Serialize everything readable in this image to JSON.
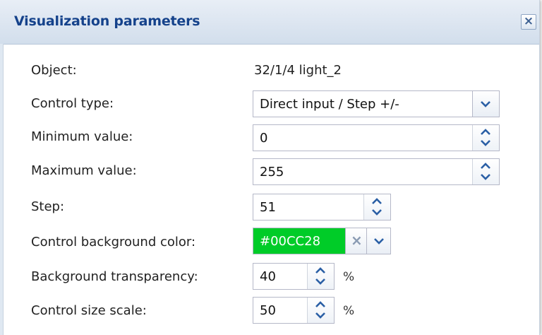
{
  "dialog": {
    "title": "Visualization parameters",
    "close_symbol": "×"
  },
  "form": {
    "object": {
      "label": "Object:",
      "value": "32/1/4 light_2"
    },
    "control_type": {
      "label": "Control type:",
      "value": "Direct input / Step +/-"
    },
    "minimum": {
      "label": "Minimum value:",
      "value": "0"
    },
    "maximum": {
      "label": "Maximum value:",
      "value": "255"
    },
    "step": {
      "label": "Step:",
      "value": "51"
    },
    "bg_color": {
      "label": "Control background color:",
      "value": "#00CC28",
      "swatch": "#00CC28",
      "clear_symbol": "×"
    },
    "transparency": {
      "label": "Background transparency:",
      "value": "40",
      "unit": "%"
    },
    "size_scale": {
      "label": "Control size scale:",
      "value": "50",
      "unit": "%"
    }
  },
  "colors": {
    "title_text": "#15428b",
    "accent_arrow": "#2a5fa5"
  }
}
